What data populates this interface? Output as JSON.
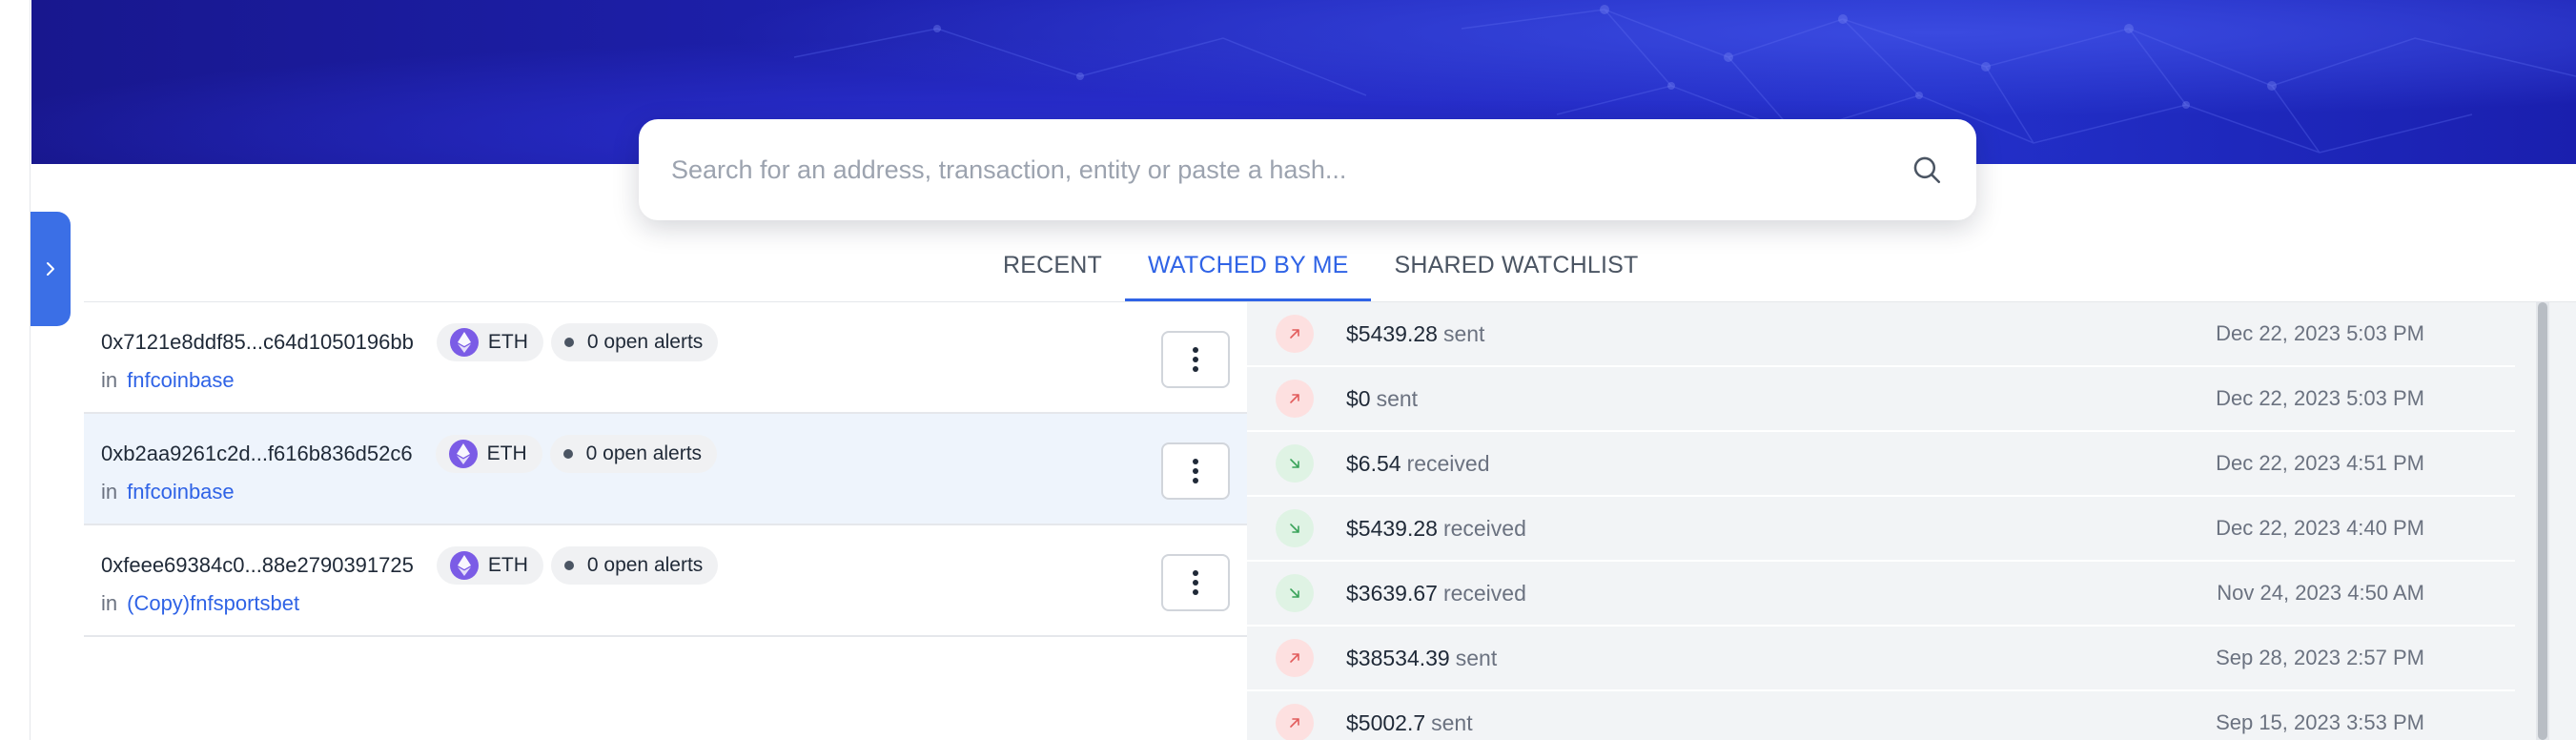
{
  "search": {
    "placeholder": "Search for an address, transaction, entity or paste a hash..."
  },
  "tabs": [
    {
      "label": "RECENT",
      "active": false
    },
    {
      "label": "WATCHED BY ME",
      "active": true
    },
    {
      "label": "SHARED WATCHLIST",
      "active": false
    }
  ],
  "watchlist": [
    {
      "address": "0x7121e8ddf85...c64d1050196bb",
      "chain": "ETH",
      "alerts": "0 open alerts",
      "in_label": "in",
      "entity": "fnfcoinbase",
      "selected": false
    },
    {
      "address": "0xb2aa9261c2d...f616b836d52c6",
      "chain": "ETH",
      "alerts": "0 open alerts",
      "in_label": "in",
      "entity": "fnfcoinbase",
      "selected": true
    },
    {
      "address": "0xfeee69384c0...88e2790391725",
      "chain": "ETH",
      "alerts": "0 open alerts",
      "in_label": "in",
      "entity": "(Copy)fnfsportsbet",
      "selected": false
    }
  ],
  "transactions": [
    {
      "amount": "$5439.28",
      "type": "sent",
      "date": "Dec 22, 2023 5:03 PM"
    },
    {
      "amount": "$0",
      "type": "sent",
      "date": "Dec 22, 2023 5:03 PM"
    },
    {
      "amount": "$6.54",
      "type": "received",
      "date": "Dec 22, 2023 4:51 PM"
    },
    {
      "amount": "$5439.28",
      "type": "received",
      "date": "Dec 22, 2023 4:40 PM"
    },
    {
      "amount": "$3639.67",
      "type": "received",
      "date": "Nov 24, 2023 4:50 AM"
    },
    {
      "amount": "$38534.39",
      "type": "sent",
      "date": "Sep 28, 2023 2:57 PM"
    },
    {
      "amount": "$5002.7",
      "type": "sent",
      "date": "Sep 15, 2023 3:53 PM"
    }
  ],
  "colors": {
    "accent": "#2f63e6",
    "eth": "#7b5ce6",
    "sent_bg": "#fde0e0",
    "sent_arrow": "#e25c5c",
    "received_bg": "#dff3e4",
    "received_arrow": "#3aa35a"
  },
  "icons": {
    "expand": "chevron-right-icon",
    "search": "search-icon",
    "chain": "ethereum-icon",
    "alert_status": "status-dot-icon",
    "menu": "kebab-menu-icon",
    "sent": "arrow-up-right-icon",
    "received": "arrow-down-right-icon"
  }
}
